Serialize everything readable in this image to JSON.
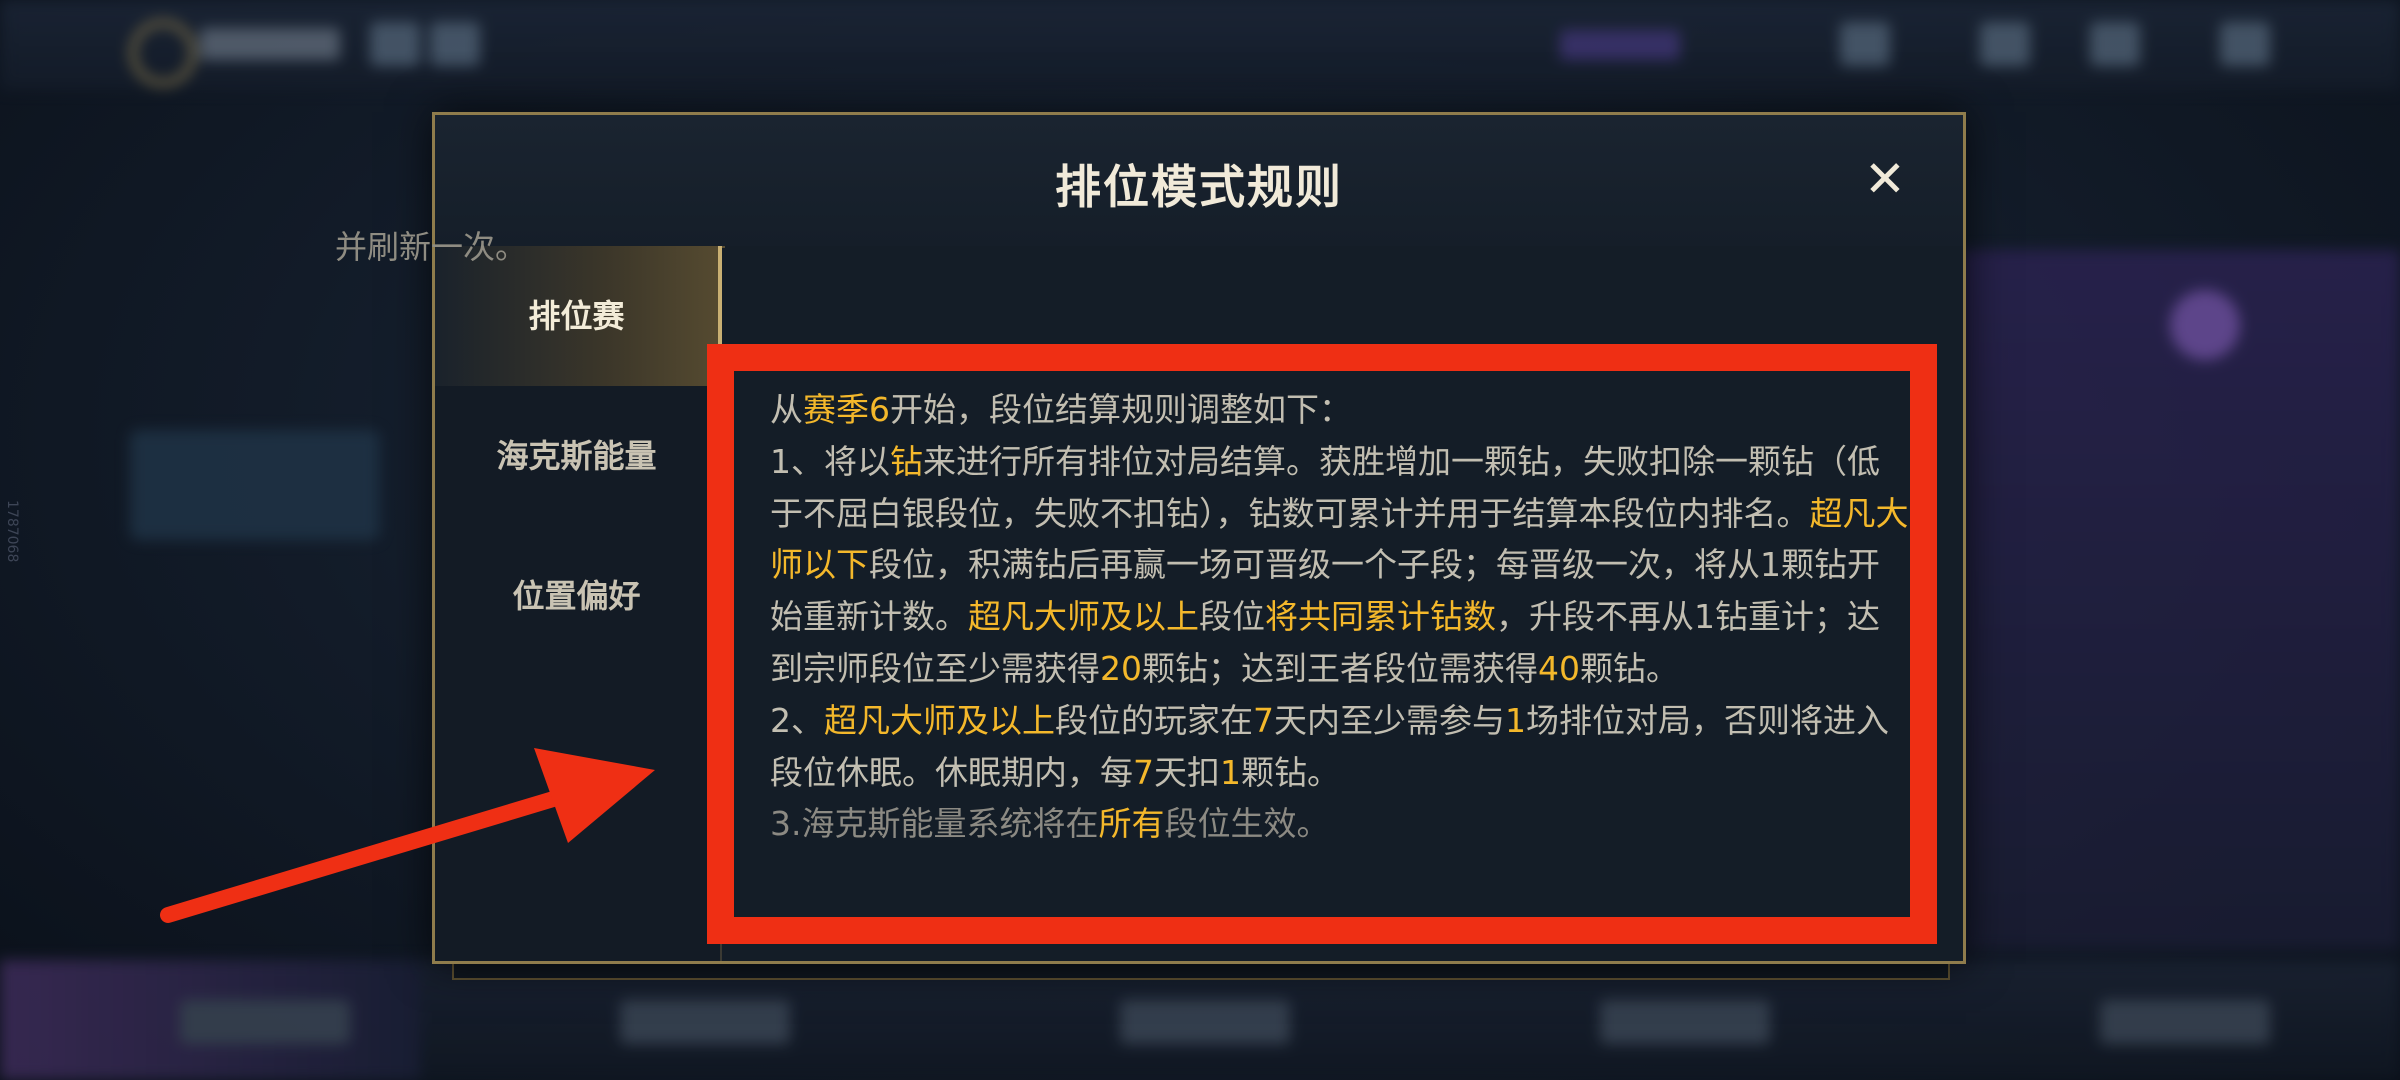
{
  "background": {
    "side_text": "1787068"
  },
  "modal": {
    "title": "排位模式规则",
    "close_glyph": "✕"
  },
  "sidebar": {
    "tabs": [
      {
        "label": "排位赛",
        "active": true
      },
      {
        "label": "海克斯能量",
        "active": false
      },
      {
        "label": "位置偏好",
        "active": false
      }
    ]
  },
  "content": {
    "previous_line": "并刷新一次。",
    "intro": {
      "a": "从",
      "b": "赛季6",
      "c": "开始，段位结算规则调整如下："
    },
    "rule1": {
      "a": "1、将以",
      "b": "钻",
      "c": "来进行所有排位对局结算。获胜增加一颗钻，失败扣除一颗钻（低于不屈白银段位，失败不扣钻），钻数可累计并用于结算本段位内排名。",
      "d": "超凡大师以下",
      "e": "段位，积满钻后再赢一场可晋级一个子段；每晋级一次，将从1颗钻开始重新计数。",
      "f": "超凡大师及以上",
      "g": "段位",
      "h": "将共同累计钻数",
      "i": "，升段不再从1钻重计；达到宗师段位至少需获得",
      "j": "20",
      "k": "颗钻；达到王者段位需获得",
      "l": "40",
      "m": "颗钻。"
    },
    "rule2": {
      "a": "2、",
      "b": "超凡大师及以上",
      "c": "段位的玩家在",
      "d": "7",
      "e": "天内至少需参与",
      "f": "1",
      "g": "场排位对局，否则将进入段位休眠。休眠期内，每",
      "h": "7",
      "i": "天扣",
      "j": "1",
      "k": "颗钻。"
    },
    "rule3": {
      "a": "3.海克斯能量系统将在",
      "b": "所有",
      "c": "段位生效。"
    }
  },
  "annotation": {
    "box_color": "#ef2f14",
    "arrow_color": "#ef2f14"
  },
  "colors": {
    "accent_gold": "#f4b82b",
    "modal_border": "#8f7c4c",
    "text": "#c2beb1"
  }
}
